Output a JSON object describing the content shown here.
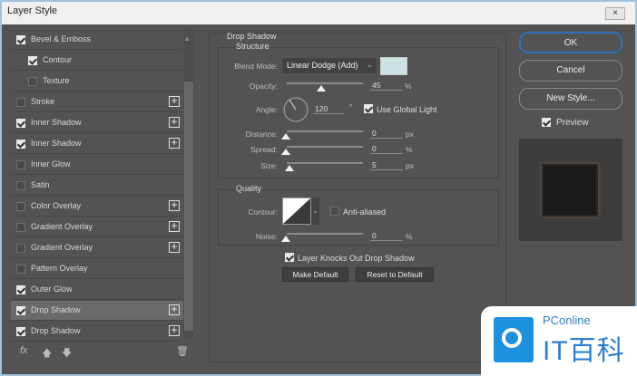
{
  "window": {
    "title": "Layer Style",
    "close_icon": "×"
  },
  "styles": [
    {
      "label": "Bevel & Emboss",
      "checked": true,
      "plus": false,
      "indent": false
    },
    {
      "label": "Contour",
      "checked": true,
      "plus": false,
      "indent": true
    },
    {
      "label": "Texture",
      "checked": false,
      "plus": false,
      "indent": true
    },
    {
      "label": "Stroke",
      "checked": false,
      "plus": true,
      "indent": false
    },
    {
      "label": "Inner Shadow",
      "checked": true,
      "plus": true,
      "indent": false
    },
    {
      "label": "Inner Shadow",
      "checked": true,
      "plus": true,
      "indent": false
    },
    {
      "label": "Inner Glow",
      "checked": false,
      "plus": false,
      "indent": false
    },
    {
      "label": "Satin",
      "checked": false,
      "plus": false,
      "indent": false
    },
    {
      "label": "Color Overlay",
      "checked": false,
      "plus": true,
      "indent": false
    },
    {
      "label": "Gradient Overlay",
      "checked": false,
      "plus": true,
      "indent": false
    },
    {
      "label": "Gradient Overlay",
      "checked": false,
      "plus": true,
      "indent": false
    },
    {
      "label": "Pattern Overlay",
      "checked": false,
      "plus": false,
      "indent": false
    },
    {
      "label": "Outer Glow",
      "checked": true,
      "plus": false,
      "indent": false
    },
    {
      "label": "Drop Shadow",
      "checked": true,
      "plus": true,
      "indent": false,
      "selected": true
    },
    {
      "label": "Drop Shadow",
      "checked": true,
      "plus": true,
      "indent": false
    }
  ],
  "toolbar": {
    "fx": "fx",
    "up": "🡅",
    "down": "🡇",
    "trash": "🗑"
  },
  "panel": {
    "title": "Drop Shadow",
    "structure": "Structure",
    "blend_mode_label": "Blend Mode:",
    "blend_mode": "Linear Dodge (Add)",
    "shadow_color": "#cde3e3",
    "opacity_label": "Opacity:",
    "opacity": "45",
    "opacity_unit": "%",
    "angle_label": "Angle:",
    "angle": "120",
    "angle_unit": "°",
    "use_global_light": "Use Global Light",
    "distance_label": "Distance:",
    "distance": "0",
    "distance_unit": "px",
    "spread_label": "Spread:",
    "spread": "0",
    "spread_unit": "%",
    "size_label": "Size:",
    "size": "5",
    "size_unit": "px",
    "quality": "Quality",
    "contour_label": "Contour:",
    "anti_aliased": "Anti-aliased",
    "noise_label": "Noise:",
    "noise": "0",
    "noise_unit": "%",
    "knocks_out": "Layer Knocks Out Drop Shadow",
    "make_default": "Make Default",
    "reset_default": "Reset to Default"
  },
  "buttons": {
    "ok": "OK",
    "cancel": "Cancel",
    "new_style": "New Style...",
    "preview": "Preview"
  },
  "watermark": {
    "brand": "PConline",
    "name": "IT百科"
  }
}
